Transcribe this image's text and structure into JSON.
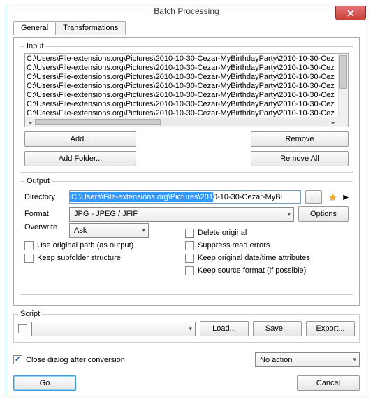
{
  "window": {
    "title": "Batch Processing"
  },
  "tabs": {
    "general": "General",
    "transformations": "Transformations"
  },
  "input": {
    "legend": "Input",
    "items": [
      "C:\\Users\\File-extensions.org\\Pictures\\2010-10-30-Cezar-MyBirthdayParty\\2010-10-30-Cez",
      "C:\\Users\\File-extensions.org\\Pictures\\2010-10-30-Cezar-MyBirthdayParty\\2010-10-30-Cez",
      "C:\\Users\\File-extensions.org\\Pictures\\2010-10-30-Cezar-MyBirthdayParty\\2010-10-30-Cez",
      "C:\\Users\\File-extensions.org\\Pictures\\2010-10-30-Cezar-MyBirthdayParty\\2010-10-30-Cez",
      "C:\\Users\\File-extensions.org\\Pictures\\2010-10-30-Cezar-MyBirthdayParty\\2010-10-30-Cez",
      "C:\\Users\\File-extensions.org\\Pictures\\2010-10-30-Cezar-MyBirthdayParty\\2010-10-30-Cez",
      "C:\\Users\\File-extensions.org\\Pictures\\2010-10-30-Cezar-MyBirthdayParty\\2010-10-30-Cez"
    ],
    "add": "Add...",
    "addFolder": "Add Folder...",
    "remove": "Remove",
    "removeAll": "Remove All"
  },
  "output": {
    "legend": "Output",
    "directoryLabel": "Directory",
    "directorySelected": "C:\\Users\\File-extensions.org\\Pictures\\201",
    "directoryRest": "0-10-30-Cezar-MyBi",
    "browse": "...",
    "formatLabel": "Format",
    "formatValue": "JPG - JPEG / JFIF",
    "options": "Options",
    "overwriteLabel": "Overwrite",
    "overwriteValue": "Ask",
    "checks": {
      "useOriginalPath": "Use original path (as output)",
      "keepSubfolder": "Keep subfolder structure",
      "deleteOriginal": "Delete original",
      "suppressErrors": "Suppress read errors",
      "keepDate": "Keep original date/time attributes",
      "keepSourceFormat": "Keep source format (if possible)"
    }
  },
  "script": {
    "legend": "Script",
    "load": "Load...",
    "save": "Save...",
    "export": "Export..."
  },
  "bottom": {
    "closeDialog": "Close dialog after conversion",
    "postAction": "No action",
    "go": "Go",
    "cancel": "Cancel"
  }
}
